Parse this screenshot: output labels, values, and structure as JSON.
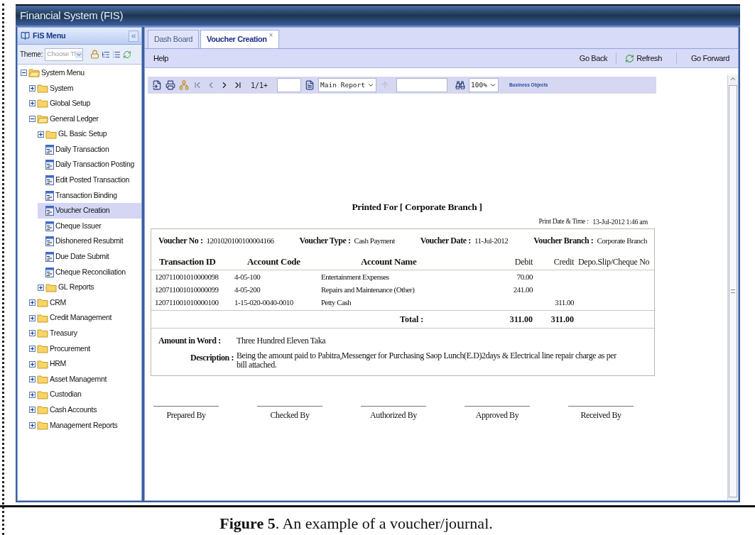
{
  "window": {
    "title": "Financial System (FIS)"
  },
  "menu": {
    "title": "FiS Menu",
    "theme_label": "Theme:",
    "theme_placeholder": "Choose Tl",
    "tree": [
      {
        "label": "System Menu",
        "kind": "folder",
        "expanded": true,
        "selected": false,
        "children": [
          {
            "label": "System",
            "kind": "folder",
            "expanded": false,
            "selected": false
          },
          {
            "label": "Global Setup",
            "kind": "folder",
            "expanded": false,
            "selected": false
          },
          {
            "label": "General Ledger",
            "kind": "folder",
            "expanded": true,
            "selected": false,
            "children": [
              {
                "label": "GL Basic Setup",
                "kind": "folder",
                "expanded": false,
                "selected": false
              },
              {
                "label": "Daily Transaction",
                "kind": "page",
                "selected": false
              },
              {
                "label": "Daily Transaction Posting",
                "kind": "page",
                "selected": false
              },
              {
                "label": "Edit Posted Transaction",
                "kind": "page",
                "selected": false
              },
              {
                "label": "Transaction Binding",
                "kind": "page",
                "selected": false
              },
              {
                "label": "Voucher Creation",
                "kind": "page",
                "selected": true
              },
              {
                "label": "Cheque Issuer",
                "kind": "page",
                "selected": false
              },
              {
                "label": "Dishonered Resubmit",
                "kind": "page",
                "selected": false
              },
              {
                "label": "Due Date Submit",
                "kind": "page",
                "selected": false
              },
              {
                "label": "Cheque Reconciliation",
                "kind": "page",
                "selected": false
              },
              {
                "label": "GL Reports",
                "kind": "folder",
                "expanded": false,
                "selected": false
              }
            ]
          },
          {
            "label": "CRM",
            "kind": "folder",
            "expanded": false,
            "selected": false
          },
          {
            "label": "Credit Management",
            "kind": "folder",
            "expanded": false,
            "selected": false
          },
          {
            "label": "Treasury",
            "kind": "folder",
            "expanded": false,
            "selected": false
          },
          {
            "label": "Procurement",
            "kind": "folder",
            "expanded": false,
            "selected": false
          },
          {
            "label": "HRM",
            "kind": "folder",
            "expanded": false,
            "selected": false
          },
          {
            "label": "Asset Managemnt",
            "kind": "folder",
            "expanded": false,
            "selected": false
          },
          {
            "label": "Custodian",
            "kind": "folder",
            "expanded": false,
            "selected": false
          },
          {
            "label": "Cash Accounts",
            "kind": "folder",
            "expanded": false,
            "selected": false
          },
          {
            "label": "Management Reports",
            "kind": "folder",
            "expanded": false,
            "selected": false
          }
        ]
      }
    ]
  },
  "tabs": [
    {
      "label": "Dash Board",
      "selected": false
    },
    {
      "label": "Voucher Creation",
      "selected": true,
      "close": "×"
    }
  ],
  "action_bar": {
    "help": "Help",
    "go_back": "Go Back",
    "refresh": "Refresh",
    "go_forward": "Go Forward"
  },
  "report_toolbar": {
    "page": "1/1+",
    "report": "Main Report",
    "zoom": "100%",
    "logo": "Business Objects"
  },
  "report": {
    "printed_for": "Printed For  [ Corporate Branch ]",
    "print_date_label": "Print Date & Time :",
    "print_date": "13-Jul-2012  1:46 am",
    "header_fields": [
      {
        "label": "Voucher No :",
        "value": "1201020100100004166"
      },
      {
        "label": "Voucher Type :",
        "value": "Cash Payment"
      },
      {
        "label": "Voucher Date :",
        "value": "11-Jul-2012"
      },
      {
        "label": "Voucher Branch :",
        "value": "Corporate Branch"
      }
    ],
    "columns": [
      "Transaction ID",
      "Account Code",
      "Account Name",
      "Debit",
      "Credit",
      "Depo.Slip/Cheque No"
    ],
    "rows": [
      [
        "120711001010000098",
        "4-05-100",
        "Entertainment Expenses",
        "70.00",
        ""
      ],
      [
        "120711001010000099",
        "4-05-200",
        "Repairs and Maintenance (Other)",
        "241.00",
        ""
      ],
      [
        "120711001010000100",
        "1-15-020-0040-0010",
        "Petty Cash",
        "",
        "311.00"
      ]
    ],
    "total_label": "Total :",
    "total_debit": "311.00",
    "total_credit": "311.00",
    "amount_label": "Amount in Word :",
    "amount_words": "Three Hundred  Eleven Taka",
    "description_label": "Description :",
    "description": "Being the amount paid to Pabitra,Messenger for Purchasing Saop Lunch(E.D)2days & Electrical line repair charge as per bill attached.",
    "signatures": [
      "Prepared By",
      "Checked By",
      "Authorized  By",
      "Approved By",
      "Received By"
    ]
  },
  "caption": "**Figure 5**. An example of a voucher/journal."
}
